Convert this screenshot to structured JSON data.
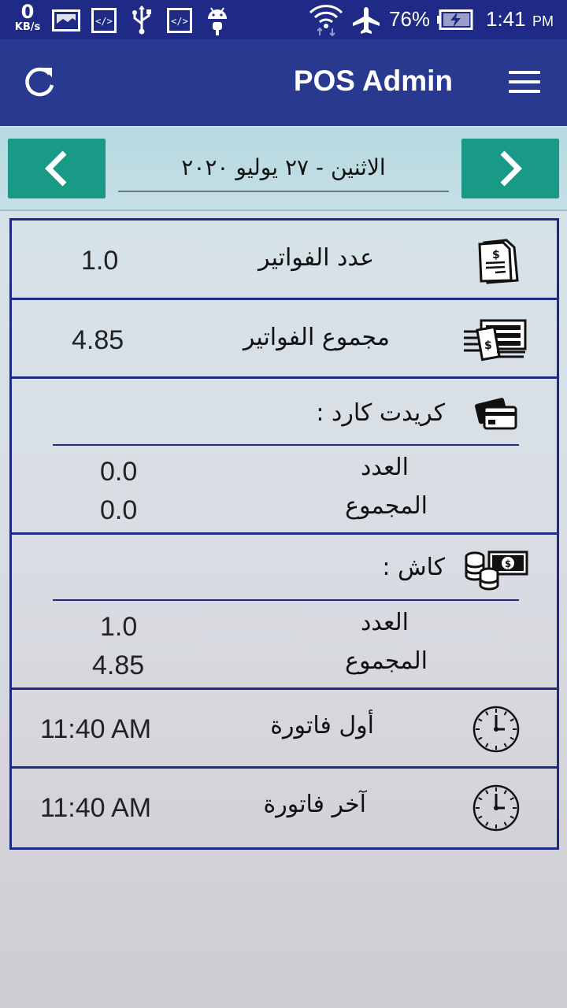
{
  "status_bar": {
    "net_speed": "0",
    "net_unit": "KB/s",
    "battery": "76%",
    "time": "1:41",
    "ampm": "PM",
    "icons": [
      "image-icon",
      "code-icon",
      "usb-icon",
      "code-icon",
      "android-icon",
      "wifi-icon",
      "airplane-icon",
      "battery-charging-icon"
    ]
  },
  "app_bar": {
    "title": "POS Admin",
    "refresh_icon": "refresh-icon",
    "menu_icon": "hamburger-menu-icon"
  },
  "date_nav": {
    "date": "الاثنين - ٢٧ يوليو ٢٠٢٠",
    "prev_icon": "chevron-left-icon",
    "next_icon": "chevron-right-icon",
    "accent_color": "#199a86"
  },
  "summary": {
    "invoice_count": {
      "label": "عدد الفواتير",
      "value": "1.0",
      "icon": "invoice-icon"
    },
    "invoice_total": {
      "label": "مجموع الفواتير",
      "value": "4.85",
      "icon": "money-stack-icon"
    },
    "credit_card": {
      "title": "كريدت كارد :",
      "icon": "credit-card-icon",
      "count_label": "العدد",
      "count_value": "0.0",
      "total_label": "المجموع",
      "total_value": "0.0"
    },
    "cash": {
      "title": "كاش :",
      "icon": "cash-coins-icon",
      "count_label": "العدد",
      "count_value": "1.0",
      "total_label": "المجموع",
      "total_value": "4.85"
    },
    "first_invoice": {
      "label": "أول فاتورة",
      "value": "11:40 AM",
      "icon": "clock-icon"
    },
    "last_invoice": {
      "label": "آخر فاتورة",
      "value": "11:40 AM",
      "icon": "clock-icon"
    }
  },
  "colors": {
    "status_bar": "#1e2a85",
    "app_bar": "#2a3990",
    "panel_border": "#1f2a85"
  }
}
